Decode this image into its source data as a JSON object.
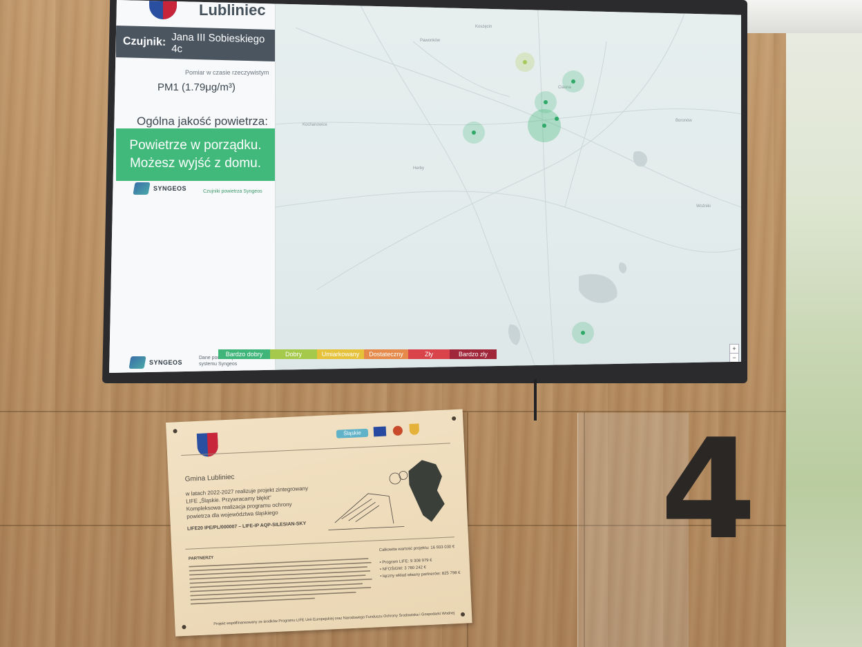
{
  "screen": {
    "city_name": "Lubliniec",
    "sensor": {
      "label": "Czujnik:",
      "value": "Jana III Sobieskiego 4c"
    },
    "realtime_caption": "Pomiar w czasie rzeczywistym",
    "pm_reading": "PM1 (1.79μg/m³)",
    "quality_title": "Ogólna jakość powietrza:",
    "quality_message_line1": "Powietrze w porządku.",
    "quality_message_line2": "Możesz wyjść z domu.",
    "brand": {
      "name": "SYNGEOS",
      "link_text": "Czujniki powietrza Syngeos",
      "footer_text": "Dane pochodzą z systemu Syngeos"
    },
    "legend": [
      {
        "label": "Bardzo dobry",
        "color": "#3fb57a"
      },
      {
        "label": "Dobry",
        "color": "#a5c94a"
      },
      {
        "label": "Umiarkowany",
        "color": "#e6c23a"
      },
      {
        "label": "Dostateczny",
        "color": "#e58a4a"
      },
      {
        "label": "Zły",
        "color": "#d9434a"
      },
      {
        "label": "Bardzo zły",
        "color": "#a0263a"
      }
    ],
    "zoom_in": "+",
    "zoom_out": "−"
  },
  "plaque": {
    "municipality": "Gmina Lubliniec",
    "project_text_1": "w latach 2022-2027 realizuje projekt zintegrowany",
    "project_text_2": "LIFE „Śląskie. Przywracamy błękit”",
    "project_text_3": "Kompleksowa realizacja programu ochrony",
    "project_text_4": "powietrza dla województwa śląskiego",
    "project_code": "LIFE20 IPE/PL/000007 – LIFE-IP AQP-SILESIAN-SKY",
    "partners_label": "PARTNERZY",
    "total_value": "Całkowita wartość projektu: 16 933 030 €",
    "funding_lines": [
      "• Program LIFE: 9 308 979 €",
      "• NFOŚiGW: 3 780 242 €",
      "• łączny wkład własny partnerów: 825 798 €"
    ],
    "footer": "Projekt współfinansowany ze środków Programu LIFE Unii Europejskiej oraz Narodowego Funduszu Ochrony Środowiska i Gospodarki Wodnej",
    "badge_text": "Śląskie"
  },
  "room_number": "4"
}
